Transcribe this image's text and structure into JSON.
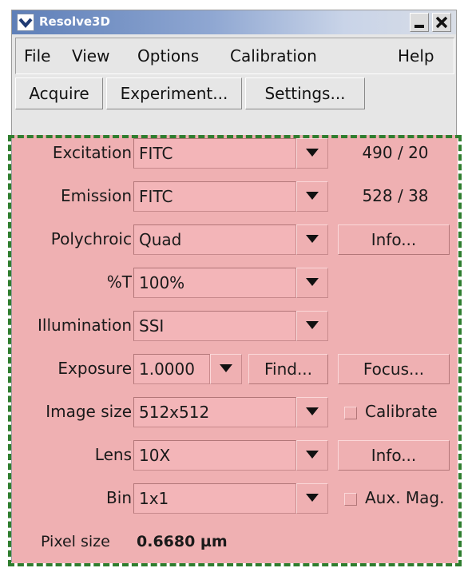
{
  "window": {
    "title": "Resolve3D",
    "icons": {
      "app": "chevron-down-icon",
      "minimize": "minimize-icon",
      "close": "close-icon"
    }
  },
  "menubar": {
    "items": [
      {
        "label": "File"
      },
      {
        "label": "View"
      },
      {
        "label": "Options"
      },
      {
        "label": "Calibration"
      },
      {
        "label": "Help"
      }
    ]
  },
  "toolbar": {
    "acquire": "Acquire",
    "experiment": "Experiment...",
    "settings": "Settings..."
  },
  "settings": {
    "excitation": {
      "label": "Excitation",
      "value": "FITC",
      "readout": "490 / 20"
    },
    "emission": {
      "label": "Emission",
      "value": "FITC",
      "readout": "528 / 38"
    },
    "polychroic": {
      "label": "Polychroic",
      "value": "Quad",
      "button": "Info..."
    },
    "transmission": {
      "label": "%T",
      "value": "100%"
    },
    "illumination": {
      "label": "Illumination",
      "value": "SSI"
    },
    "exposure": {
      "label": "Exposure",
      "value": "1.0000",
      "find_button": "Find...",
      "focus_button": "Focus..."
    },
    "image_size": {
      "label": "Image size",
      "value": "512x512",
      "checkbox_label": "Calibrate",
      "checked": false
    },
    "lens": {
      "label": "Lens",
      "value": "10X",
      "button": "Info..."
    },
    "bin": {
      "label": "Bin",
      "value": "1x1",
      "checkbox_label": "Aux. Mag.",
      "checked": false
    },
    "pixel_size": {
      "label": "Pixel size",
      "value": "0.6680 µm"
    }
  },
  "colors": {
    "titlebar": "#5e7fb8",
    "panel": "#efb0b2",
    "dashed_outline": "#2f7e2f"
  }
}
